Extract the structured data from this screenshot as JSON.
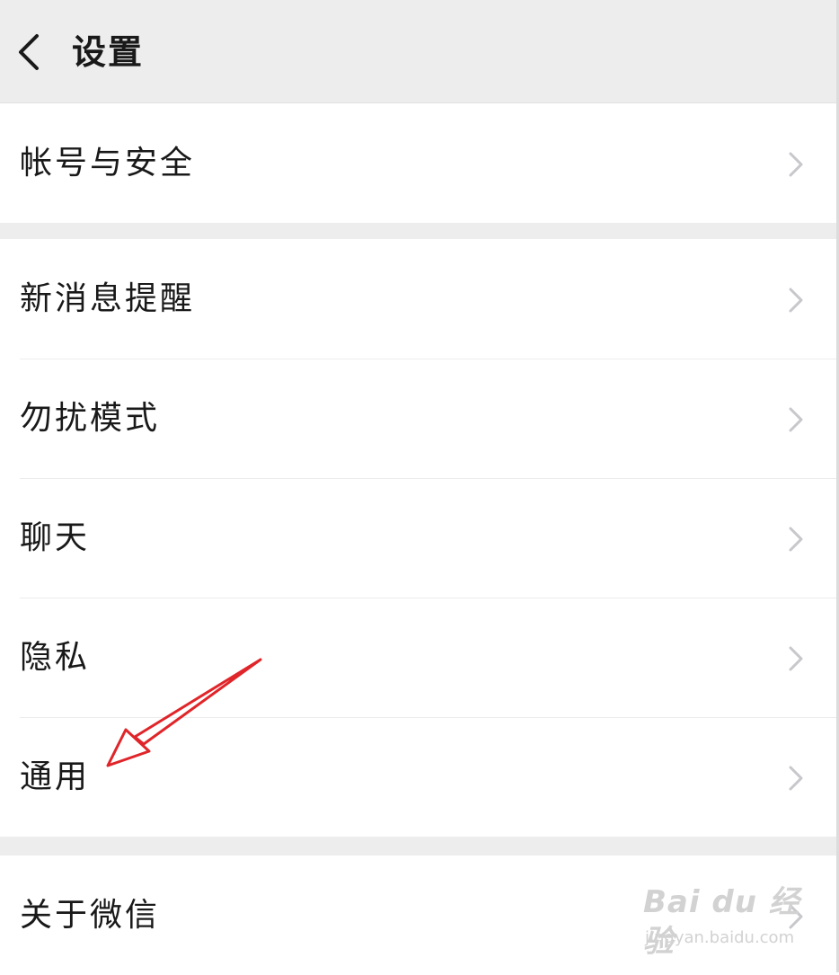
{
  "header": {
    "title": "设置",
    "back_icon": "chevron-left-icon"
  },
  "groups": [
    {
      "items": [
        {
          "label": "帐号与安全"
        }
      ]
    },
    {
      "items": [
        {
          "label": "新消息提醒"
        },
        {
          "label": "勿扰模式"
        },
        {
          "label": "聊天"
        },
        {
          "label": "隐私"
        },
        {
          "label": "通用"
        }
      ]
    },
    {
      "items": [
        {
          "label": "关于微信"
        }
      ]
    }
  ],
  "annotation": {
    "arrow_color": "#e0252a",
    "points_to": "通用"
  },
  "watermark": {
    "brand": "Bai du 经验",
    "domain": "jingyan.baidu.com"
  }
}
